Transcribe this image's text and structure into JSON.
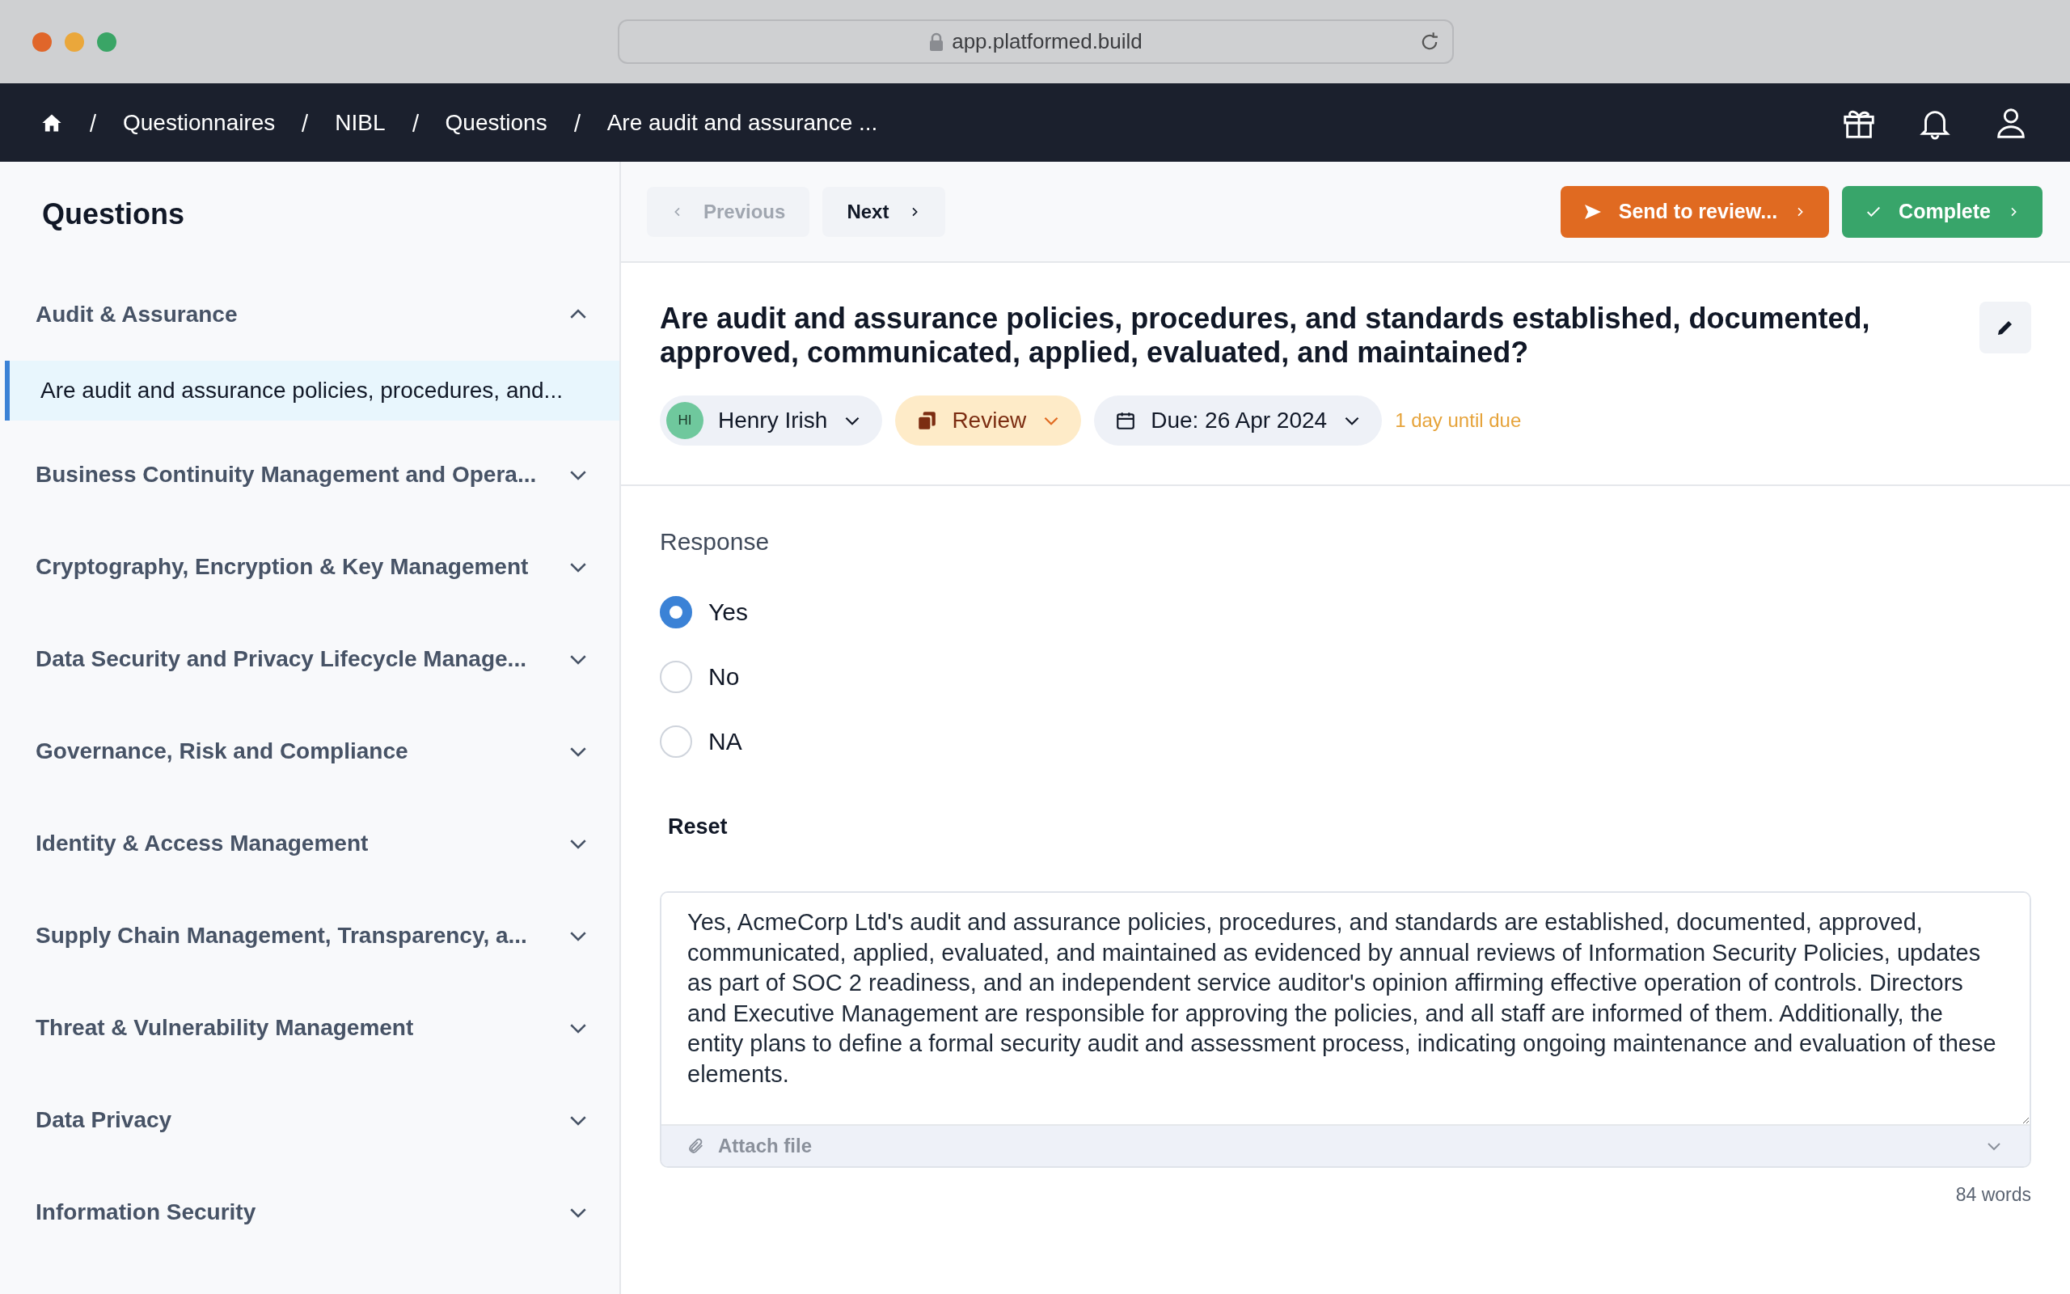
{
  "browser": {
    "url": "app.platformed.build"
  },
  "breadcrumbs": [
    "Questionnaires",
    "NIBL",
    "Questions",
    "Are audit and assurance ..."
  ],
  "sidebar": {
    "title": "Questions",
    "sections": [
      {
        "label": "Audit & Assurance",
        "expanded": true,
        "items": [
          {
            "label": "Are audit and assurance policies, procedures, and...",
            "selected": true
          }
        ]
      },
      {
        "label": "Business Continuity Management and Opera...",
        "expanded": false
      },
      {
        "label": "Cryptography, Encryption & Key Management",
        "expanded": false
      },
      {
        "label": "Data Security and Privacy Lifecycle Manage...",
        "expanded": false
      },
      {
        "label": "Governance, Risk and Compliance",
        "expanded": false
      },
      {
        "label": "Identity & Access Management",
        "expanded": false
      },
      {
        "label": "Supply Chain Management, Transparency, a...",
        "expanded": false
      },
      {
        "label": "Threat & Vulnerability Management",
        "expanded": false
      },
      {
        "label": "Data Privacy",
        "expanded": false
      },
      {
        "label": "Information Security",
        "expanded": false
      }
    ]
  },
  "toolbar": {
    "previous": {
      "label": "Previous",
      "disabled": true
    },
    "next": {
      "label": "Next",
      "disabled": false
    },
    "send_to_review": "Send to review...",
    "complete": "Complete"
  },
  "question": {
    "title": "Are audit and assurance policies, procedures, and standards established, documented, approved, communicated, applied, evaluated, and maintained?",
    "assignee": {
      "initials": "HI",
      "name": "Henry Irish"
    },
    "status": "Review",
    "due": "Due: 26 Apr 2024",
    "due_note": "1 day until due"
  },
  "response": {
    "label": "Response",
    "options": [
      {
        "label": "Yes",
        "selected": true
      },
      {
        "label": "No",
        "selected": false
      },
      {
        "label": "NA",
        "selected": false
      }
    ],
    "reset": "Reset",
    "answer": "Yes, AcmeCorp Ltd's audit and assurance policies, procedures, and standards are established, documented, approved, communicated, applied, evaluated, and maintained as evidenced by annual reviews of Information Security Policies, updates as part of SOC 2 readiness, and an independent service auditor's opinion affirming effective operation of controls. Directors and Executive Management are responsible for approving the policies, and all staff are informed of them. Additionally, the entity plans to define a formal security audit and assessment process, indicating ongoing maintenance and evaluation of these elements.",
    "attach": "Attach file",
    "word_count": "84 words"
  }
}
